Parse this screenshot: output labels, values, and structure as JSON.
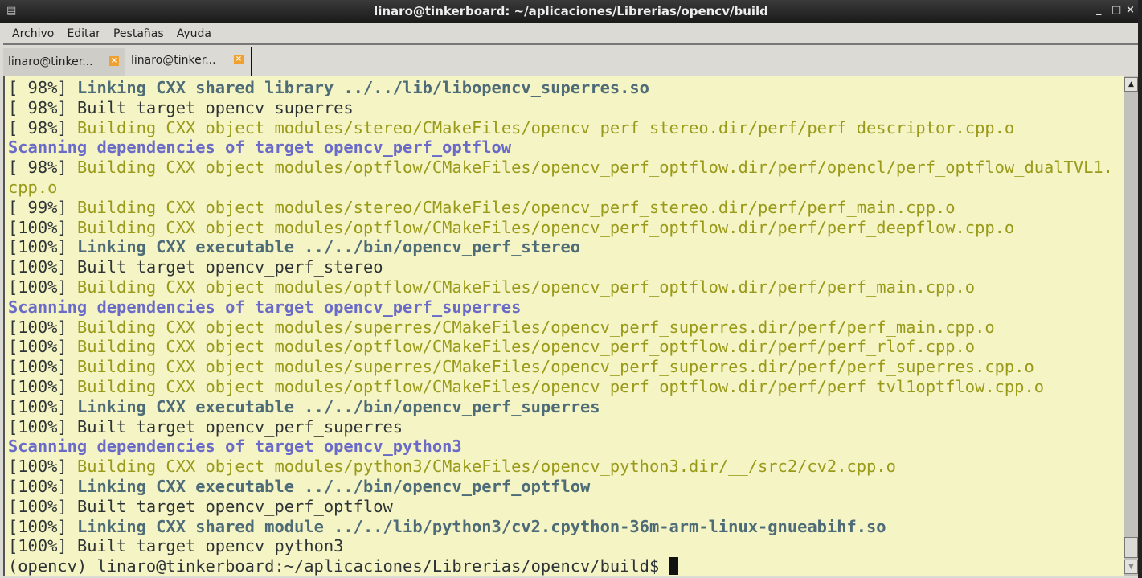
{
  "window": {
    "title": "linaro@tinkerboard: ~/aplicaciones/Librerias/opencv/build"
  },
  "menu": [
    "Archivo",
    "Editar",
    "Pestañas",
    "Ayuda"
  ],
  "tabs": [
    {
      "label": "linaro@tinker...",
      "active": false
    },
    {
      "label": "linaro@tinker...",
      "active": true
    }
  ],
  "colors": {
    "background": "#f5f4c4",
    "building": "#9a9a1a",
    "linking": "#4e6b78",
    "scanning": "#6a6ac8",
    "tab_close": "#f0a030"
  },
  "terminal": {
    "lines": [
      {
        "prefix": "[ 98%] ",
        "text": "Linking CXX shared library ../../lib/libopencv_superres.so",
        "style": "link"
      },
      {
        "prefix": "[ 98%] ",
        "text": "Built target opencv_superres",
        "style": "plain"
      },
      {
        "prefix": "[ 98%] ",
        "text": "Building CXX object modules/stereo/CMakeFiles/opencv_perf_stereo.dir/perf/perf_descriptor.cpp.o",
        "style": "build"
      },
      {
        "prefix": "",
        "text": "Scanning dependencies of target opencv_perf_optflow",
        "style": "scan"
      },
      {
        "prefix": "[ 98%] ",
        "text": "Building CXX object modules/optflow/CMakeFiles/opencv_perf_optflow.dir/perf/opencl/perf_optflow_dualTVL1.",
        "style": "build"
      },
      {
        "prefix": "",
        "text": "cpp.o",
        "style": "build"
      },
      {
        "prefix": "[ 99%] ",
        "text": "Building CXX object modules/stereo/CMakeFiles/opencv_perf_stereo.dir/perf/perf_main.cpp.o",
        "style": "build"
      },
      {
        "prefix": "[100%] ",
        "text": "Building CXX object modules/optflow/CMakeFiles/opencv_perf_optflow.dir/perf/perf_deepflow.cpp.o",
        "style": "build"
      },
      {
        "prefix": "[100%] ",
        "text": "Linking CXX executable ../../bin/opencv_perf_stereo",
        "style": "link"
      },
      {
        "prefix": "[100%] ",
        "text": "Built target opencv_perf_stereo",
        "style": "plain"
      },
      {
        "prefix": "[100%] ",
        "text": "Building CXX object modules/optflow/CMakeFiles/opencv_perf_optflow.dir/perf/perf_main.cpp.o",
        "style": "build"
      },
      {
        "prefix": "",
        "text": "Scanning dependencies of target opencv_perf_superres",
        "style": "scan"
      },
      {
        "prefix": "[100%] ",
        "text": "Building CXX object modules/superres/CMakeFiles/opencv_perf_superres.dir/perf/perf_main.cpp.o",
        "style": "build"
      },
      {
        "prefix": "[100%] ",
        "text": "Building CXX object modules/optflow/CMakeFiles/opencv_perf_optflow.dir/perf/perf_rlof.cpp.o",
        "style": "build"
      },
      {
        "prefix": "[100%] ",
        "text": "Building CXX object modules/superres/CMakeFiles/opencv_perf_superres.dir/perf/perf_superres.cpp.o",
        "style": "build"
      },
      {
        "prefix": "[100%] ",
        "text": "Building CXX object modules/optflow/CMakeFiles/opencv_perf_optflow.dir/perf/perf_tvl1optflow.cpp.o",
        "style": "build"
      },
      {
        "prefix": "[100%] ",
        "text": "Linking CXX executable ../../bin/opencv_perf_superres",
        "style": "link"
      },
      {
        "prefix": "[100%] ",
        "text": "Built target opencv_perf_superres",
        "style": "plain"
      },
      {
        "prefix": "",
        "text": "Scanning dependencies of target opencv_python3",
        "style": "scan"
      },
      {
        "prefix": "[100%] ",
        "text": "Building CXX object modules/python3/CMakeFiles/opencv_python3.dir/__/src2/cv2.cpp.o",
        "style": "build"
      },
      {
        "prefix": "[100%] ",
        "text": "Linking CXX executable ../../bin/opencv_perf_optflow",
        "style": "link"
      },
      {
        "prefix": "[100%] ",
        "text": "Built target opencv_perf_optflow",
        "style": "plain"
      },
      {
        "prefix": "[100%] ",
        "text": "Linking CXX shared module ../../lib/python3/cv2.cpython-36m-arm-linux-gnueabihf.so",
        "style": "link"
      },
      {
        "prefix": "[100%] ",
        "text": "Built target opencv_python3",
        "style": "plain"
      }
    ],
    "prompt": "(opencv) linaro@tinkerboard:~/aplicaciones/Librerias/opencv/build$ "
  }
}
